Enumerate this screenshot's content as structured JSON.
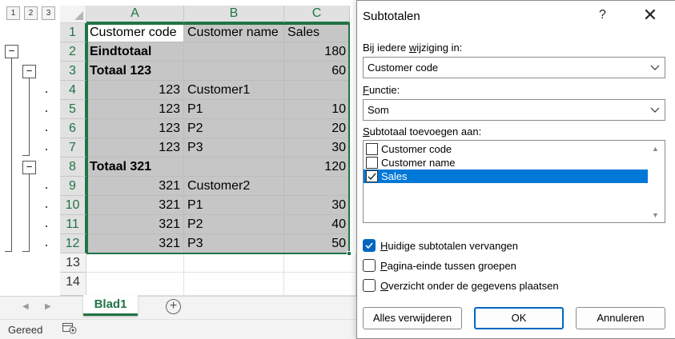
{
  "outline": {
    "levels": [
      "1",
      "2",
      "3"
    ],
    "collapse_symbol": "−"
  },
  "columns": [
    "A",
    "B",
    "C"
  ],
  "rows": [
    {
      "num": "1",
      "a": "Customer code",
      "b": "Customer name",
      "c": "Sales",
      "bold": false,
      "header": true
    },
    {
      "num": "2",
      "a": "Eindtotaal",
      "b": "",
      "c": "180",
      "bold": true
    },
    {
      "num": "3",
      "a": "Totaal 123",
      "b": "",
      "c": "60",
      "bold": true
    },
    {
      "num": "4",
      "a": "123",
      "b": "Customer1",
      "c": "",
      "bold": false
    },
    {
      "num": "5",
      "a": "123",
      "b": "P1",
      "c": "10",
      "bold": false
    },
    {
      "num": "6",
      "a": "123",
      "b": "P2",
      "c": "20",
      "bold": false
    },
    {
      "num": "7",
      "a": "123",
      "b": "P3",
      "c": "30",
      "bold": false
    },
    {
      "num": "8",
      "a": "Totaal 321",
      "b": "",
      "c": "120",
      "bold": true
    },
    {
      "num": "9",
      "a": "321",
      "b": "Customer2",
      "c": "",
      "bold": false
    },
    {
      "num": "10",
      "a": "321",
      "b": "P1",
      "c": "30",
      "bold": false
    },
    {
      "num": "11",
      "a": "321",
      "b": "P2",
      "c": "40",
      "bold": false
    },
    {
      "num": "12",
      "a": "321",
      "b": "P3",
      "c": "50",
      "bold": false
    }
  ],
  "blank_rows": [
    "13",
    "14"
  ],
  "sheet": {
    "tab": "Blad1",
    "add_symbol": "+",
    "prev_arrow": "◀",
    "next_arrow": "▶"
  },
  "status": {
    "text": "Gereed"
  },
  "dialog": {
    "title": "Subtotalen",
    "help": "?",
    "close": "✕",
    "change_label_pre": "Bij iedere ",
    "change_label_u": "w",
    "change_label_post": "ijziging in:",
    "change_value": "Customer code",
    "function_label_u": "F",
    "function_label_post": "unctie:",
    "function_value": "Som",
    "add_label_u": "S",
    "add_label_post": "ubtotaal toevoegen aan:",
    "add_items": [
      {
        "label": "Customer code",
        "checked": false,
        "selected": false
      },
      {
        "label": "Customer name",
        "checked": false,
        "selected": false
      },
      {
        "label": "Sales",
        "checked": true,
        "selected": true
      }
    ],
    "options": [
      {
        "u": "H",
        "rest": "uidige subtotalen vervangen",
        "checked": true
      },
      {
        "u": "P",
        "rest": "agina-einde tussen groepen",
        "checked": false
      },
      {
        "u": "O",
        "rest": "verzicht onder de gegevens plaatsen",
        "checked": false
      }
    ],
    "buttons": {
      "remove_all": "Alles verwijderen",
      "ok": "OK",
      "cancel": "Annuleren"
    },
    "accent": "#0067c0"
  },
  "colors": {
    "excel_green": "#217346",
    "selection_fill": "#c6c6c6"
  }
}
